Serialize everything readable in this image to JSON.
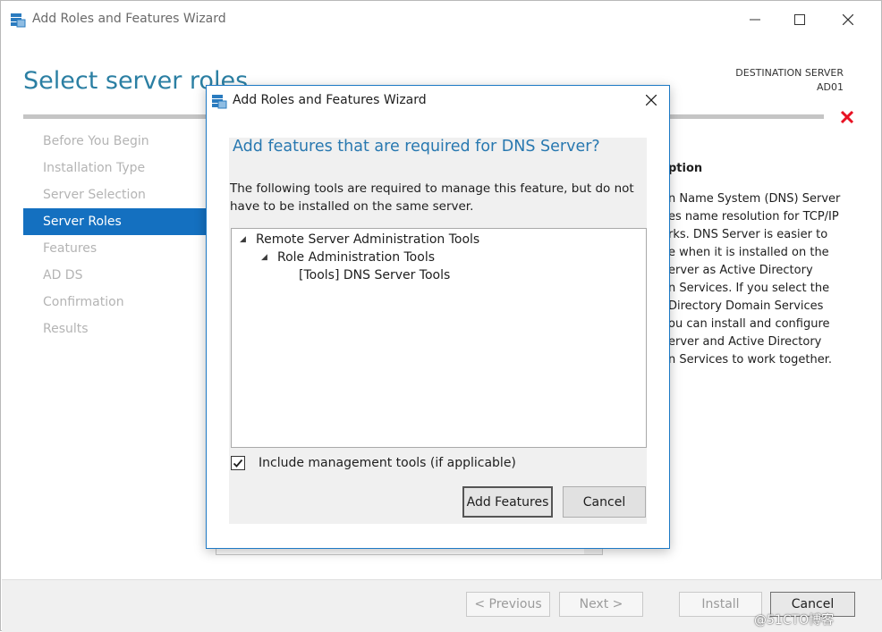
{
  "main_window": {
    "title": "Add Roles and Features Wizard",
    "page_title": "Select server roles",
    "destination_label": "DESTINATION SERVER",
    "destination_server": "AD01",
    "nav_items": [
      {
        "label": "Before You Begin",
        "active": false
      },
      {
        "label": "Installation Type",
        "active": false
      },
      {
        "label": "Server Selection",
        "active": false
      },
      {
        "label": "Server Roles",
        "active": true
      },
      {
        "label": "Features",
        "active": false
      },
      {
        "label": "AD DS",
        "active": false
      },
      {
        "label": "Confirmation",
        "active": false
      },
      {
        "label": "Results",
        "active": false
      }
    ],
    "description_heading": "ption",
    "description_lines": [
      "n Name System (DNS) Server",
      "es name resolution for TCP/IP",
      "rks. DNS Server is easier to",
      "e when it is installed on the",
      "erver as Active Directory",
      "n Services. If you select the",
      "Directory Domain Services",
      "ou can install and configure",
      "erver and Active Directory",
      "n Services to work together."
    ],
    "buttons": {
      "previous": "< Previous",
      "next": "Next >",
      "install": "Install",
      "cancel": "Cancel"
    },
    "watermark": "@51CTO博客"
  },
  "dialog": {
    "title": "Add Roles and Features Wizard",
    "heading": "Add features that are required for DNS Server?",
    "description": "The following tools are required to manage this feature, but do not have to be installed on the same server.",
    "tree": [
      {
        "label": "Remote Server Administration Tools",
        "expanded": true
      },
      {
        "label": "Role Administration Tools",
        "expanded": true
      },
      {
        "label": "[Tools] DNS Server Tools",
        "expanded": null
      }
    ],
    "include_tools_label": "Include management tools (if applicable)",
    "include_tools_checked": true,
    "add_button": "Add Features",
    "cancel_button": "Cancel"
  },
  "colors": {
    "accent_blue": "#1470c0",
    "title_blue": "#2b7fa3",
    "error_red": "#e81123"
  },
  "icons": [
    "wizard-icon",
    "minimize-icon",
    "maximize-icon",
    "close-icon",
    "error-x-icon",
    "expanded-triangle-icon",
    "checkmark-icon"
  ]
}
